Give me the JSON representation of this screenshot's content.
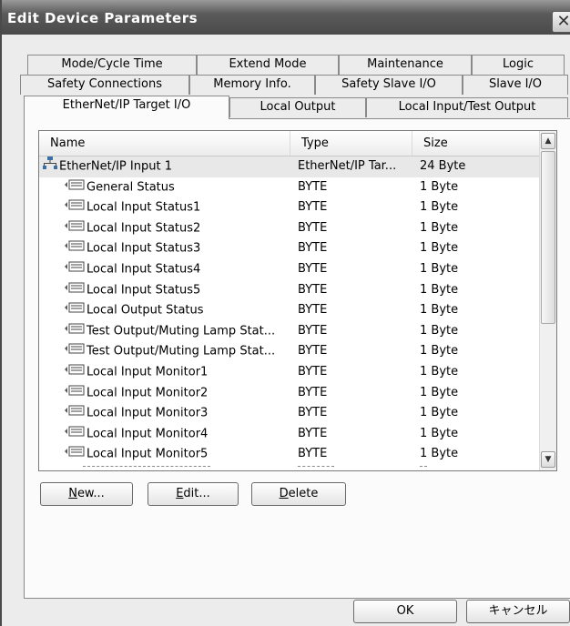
{
  "window": {
    "title": "Edit Device Parameters",
    "close_glyph": "✕"
  },
  "tabs": {
    "row1": [
      "Mode/Cycle Time",
      "Extend Mode",
      "Maintenance",
      "Logic"
    ],
    "row2": [
      "Safety Connections",
      "Memory Info.",
      "Safety Slave I/O",
      "Slave I/O"
    ],
    "row3": [
      "EtherNet/IP Target I/O",
      "Local Output",
      "Local Input/Test Output"
    ],
    "active": "EtherNet/IP Target I/O"
  },
  "list": {
    "columns": [
      "Name",
      "Type",
      "Size"
    ],
    "rows": [
      {
        "name": "EtherNet/IP Input 1",
        "type": "EtherNet/IP Tar...",
        "size": "24 Byte",
        "icon": "network-icon",
        "level": 0
      },
      {
        "name": "General Status",
        "type": "BYTE",
        "size": "1 Byte",
        "icon": "tag-icon",
        "level": 1
      },
      {
        "name": "Local Input Status1",
        "type": "BYTE",
        "size": "1 Byte",
        "icon": "tag-icon",
        "level": 1
      },
      {
        "name": "Local Input Status2",
        "type": "BYTE",
        "size": "1 Byte",
        "icon": "tag-icon",
        "level": 1
      },
      {
        "name": "Local Input Status3",
        "type": "BYTE",
        "size": "1 Byte",
        "icon": "tag-icon",
        "level": 1
      },
      {
        "name": "Local Input Status4",
        "type": "BYTE",
        "size": "1 Byte",
        "icon": "tag-icon",
        "level": 1
      },
      {
        "name": "Local Input Status5",
        "type": "BYTE",
        "size": "1 Byte",
        "icon": "tag-icon",
        "level": 1
      },
      {
        "name": "Local Output Status",
        "type": "BYTE",
        "size": "1 Byte",
        "icon": "tag-icon",
        "level": 1
      },
      {
        "name": "Test Output/Muting Lamp Stat...",
        "type": "BYTE",
        "size": "1 Byte",
        "icon": "tag-icon",
        "level": 1
      },
      {
        "name": "Test Output/Muting Lamp Stat...",
        "type": "BYTE",
        "size": "1 Byte",
        "icon": "tag-icon",
        "level": 1
      },
      {
        "name": "Local Input Monitor1",
        "type": "BYTE",
        "size": "1 Byte",
        "icon": "tag-icon",
        "level": 1
      },
      {
        "name": "Local Input Monitor2",
        "type": "BYTE",
        "size": "1 Byte",
        "icon": "tag-icon",
        "level": 1
      },
      {
        "name": "Local Input Monitor3",
        "type": "BYTE",
        "size": "1 Byte",
        "icon": "tag-icon",
        "level": 1
      },
      {
        "name": "Local Input Monitor4",
        "type": "BYTE",
        "size": "1 Byte",
        "icon": "tag-icon",
        "level": 1
      },
      {
        "name": "Local Input Monitor5",
        "type": "BYTE",
        "size": "1 Byte",
        "icon": "tag-icon",
        "level": 1
      }
    ]
  },
  "buttons": {
    "new_mnemonic": "N",
    "new_rest": "ew...",
    "edit_mnemonic": "E",
    "edit_rest": "dit...",
    "delete_mnemonic": "D",
    "delete_rest": "elete",
    "ok": "OK",
    "cancel": "キャンセル"
  },
  "colors": {
    "title_bar": "#5a5a5a",
    "selected_row": "#e8e8e8"
  }
}
